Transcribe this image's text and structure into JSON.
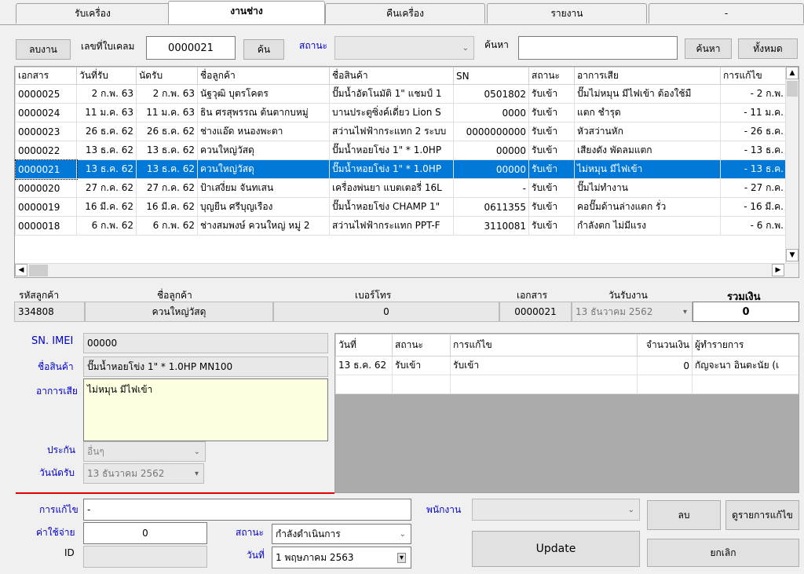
{
  "tabs": [
    "รับเครื่อง",
    "งานช่าง",
    "คืนเครื่อง",
    "รายงาน",
    "-"
  ],
  "toolbar": {
    "delete_job": "ลบงาน",
    "claim_label": "เลขที่ใบเคลม",
    "claim_value": "0000021",
    "find": "ค้น",
    "status_label": "สถานะ",
    "status_value": "",
    "search_label": "ค้นหา",
    "search_value": "",
    "search_btn": "ค้นหา",
    "all_btn": "ทั้งหมด"
  },
  "grid": {
    "headers": [
      "เอกสาร",
      "วันที่รับ",
      "นัดรับ",
      "ชื่อลูกค้า",
      "ชื่อสินค้า",
      "SN",
      "สถานะ",
      "อาการเสีย",
      "การแก้ไข"
    ],
    "rows": [
      [
        "0000025",
        "2 ก.พ. 63",
        "2 ก.พ. 63",
        "นัฐวุฒิ บุตรโคตร",
        "ปั๊มน้ำอัตโนมัติ 1\" แชมป์ 1",
        "0501802",
        "รับเข้า",
        "ปั๊มไม่หมุน มีไฟเข้า ต้องใช้มื",
        "- 2 ก.พ."
      ],
      [
        "0000024",
        "11 ม.ค. 63",
        "11 ม.ค. 63",
        "ธิน ศรสุพรรณ ต้นตากบหมู่",
        "บานประตูซิ่งค์เดี่ยว Lion S",
        "0000",
        "รับเข้า",
        "แตก ชำรุด",
        "- 11 ม.ค."
      ],
      [
        "0000023",
        "26 ธ.ค. 62",
        "26 ธ.ค. 62",
        "ช่างแอ๊ด หนองพะตา",
        "สว่านไฟฟ้ากระแทก 2 ระบบ",
        "0000000000",
        "รับเข้า",
        "หัวสว่านหัก",
        "- 26 ธ.ค."
      ],
      [
        "0000022",
        "13 ธ.ค. 62",
        "13 ธ.ค. 62",
        "ควนใหญ่วัสดุ",
        "ปั๊มน้ำหอยโข่ง 1\" * 1.0HP",
        "00000",
        "รับเข้า",
        "เสียงดัง พัดลมแตก",
        "- 13 ธ.ค."
      ],
      [
        "0000021",
        "13 ธ.ค. 62",
        "13 ธ.ค. 62",
        "ควนใหญ่วัสดุ",
        "ปั๊มน้ำหอยโข่ง 1\" * 1.0HP",
        "00000",
        "รับเข้า",
        "ไม่หมุน มีไฟเข้า",
        "- 13 ธ.ค."
      ],
      [
        "0000020",
        "27 ก.ค. 62",
        "27 ก.ค. 62",
        "ป้าเสงี่ยม จันทเสน",
        "เครื่องพ่นยา แบตเตอรี่ 16L",
        "-",
        "รับเข้า",
        "ปั๊มไม่ทำงาน",
        "- 27 ก.ค."
      ],
      [
        "0000019",
        "16 มี.ค. 62",
        "16 มี.ค. 62",
        "บุญยืน ศรีบุญเรือง",
        "ปั๊มน้ำหอยโข่ง CHAMP 1\"",
        "0611355",
        "รับเข้า",
        "คอปั๊มด้านล่างแตก รั่ว",
        "- 16 มี.ค."
      ],
      [
        "0000018",
        "6 ก.พ. 62",
        "6 ก.พ. 62",
        "ช่างสมพงษ์ ควนใหญ่ หมู่ 2",
        "สว่านไฟฟ้ากระแทก PPT-F",
        "3110081",
        "รับเข้า",
        "กำลังตก ไม่มีแรง",
        "- 6 ก.พ."
      ]
    ],
    "selected_index": 4
  },
  "summary": {
    "cust_id_label": "รหัสลูกค้า",
    "cust_id": "334808",
    "cust_name_label": "ชื่อลูกค้า",
    "cust_name": "ควนใหญ่วัสดุ",
    "phone_label": "เบอร์โทร",
    "phone": "0",
    "doc_label": "เอกสาร",
    "doc": "0000021",
    "recv_date_label": "วันรับงาน",
    "recv_date": "13  ธันวาคม   2562",
    "total_label": "รวมเงิน",
    "total": "0"
  },
  "detail": {
    "sn_label": "SN. IMEI",
    "sn": "00000",
    "product_label": "ชื่อสินค้า",
    "product": "ปั๊มน้ำหอยโข่ง 1\" * 1.0HP MN100",
    "symptom_label": "อาการเสีย",
    "symptom": "ไม่หมุน มีไฟเข้า",
    "warranty_label": "ประกัน",
    "warranty": "อื่นๆ",
    "appoint_label": "วันนัดรับ",
    "appoint": "13  ธันวาคม   2562"
  },
  "history": {
    "headers": [
      "วันที่",
      "สถานะ",
      "การแก้ไข",
      "จำนวนเงิน",
      "ผู้ทำรายการ"
    ],
    "rows": [
      [
        "13 ธ.ค. 62",
        "รับเข้า",
        "รับเข้า",
        "0",
        "กัญจะนา อินตะนัย (เ"
      ]
    ]
  },
  "form": {
    "fix_label": "การแก้ไข",
    "fix": "-",
    "cost_label": "ค่าใช้จ่าย",
    "cost": "0",
    "id_label": "ID",
    "id": "",
    "status_label": "สถานะ",
    "status": "กำลังดำเนินการ",
    "date_label": "วันที่",
    "date": "1  พฤษภาคม  2563",
    "staff_label": "พนักงาน",
    "staff": "",
    "update": "Update",
    "delete": "ลบ",
    "view_fix": "ดูรายการแก้ไข",
    "cancel": "ยกเลิก"
  },
  "colors": {
    "selection": "#0078d7",
    "label_blue": "#0000cc",
    "red_line": "#e00000",
    "memo_yellow": "#ffffe1"
  }
}
